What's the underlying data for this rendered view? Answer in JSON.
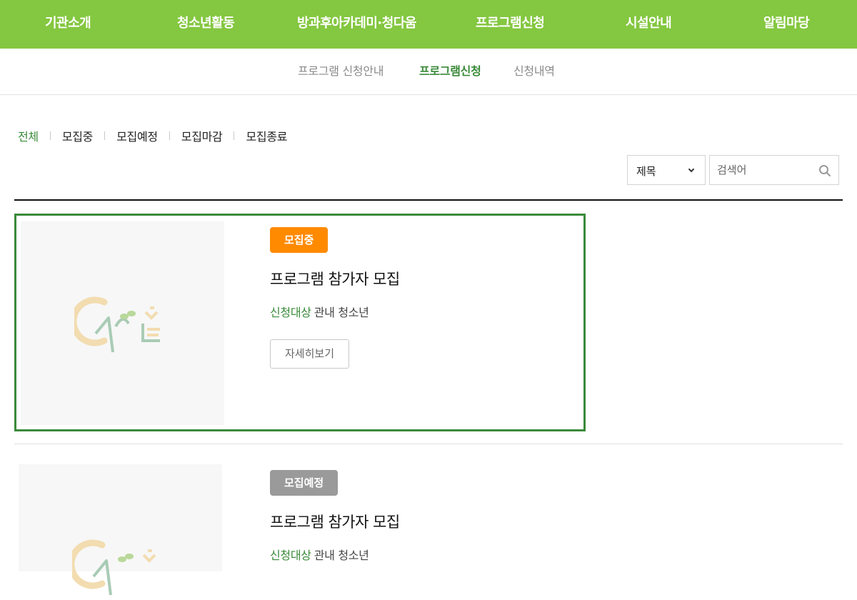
{
  "top_nav": [
    "기관소개",
    "청소년활동",
    "방과후아카데미·청다움",
    "프로그램신청",
    "시설안내",
    "알림마당"
  ],
  "sub_nav": [
    {
      "label": "프로그램 신청안내",
      "active": false
    },
    {
      "label": "프로그램신청",
      "active": true
    },
    {
      "label": "신청내역",
      "active": false
    }
  ],
  "filters": [
    {
      "label": "전체",
      "active": true
    },
    {
      "label": "모집중",
      "active": false
    },
    {
      "label": "모집예정",
      "active": false
    },
    {
      "label": "모집마감",
      "active": false
    },
    {
      "label": "모집종료",
      "active": false
    }
  ],
  "search": {
    "field_selected": "제목",
    "placeholder": "검색어"
  },
  "programs": [
    {
      "status": "모집중",
      "title": "프로그램 참가자 모집",
      "target_label": "신청대상",
      "target_value": "관내 청소년",
      "detail_label": "자세히보기"
    },
    {
      "status": "모집예정",
      "title": "프로그램 참가자 모집",
      "target_label": "신청대상",
      "target_value": "관내 청소년"
    }
  ],
  "colors": {
    "brand_green": "#84c740",
    "accent_green": "#3a8a3a",
    "badge_open": "#ff8a00",
    "badge_upcoming": "#9a9a9a"
  }
}
